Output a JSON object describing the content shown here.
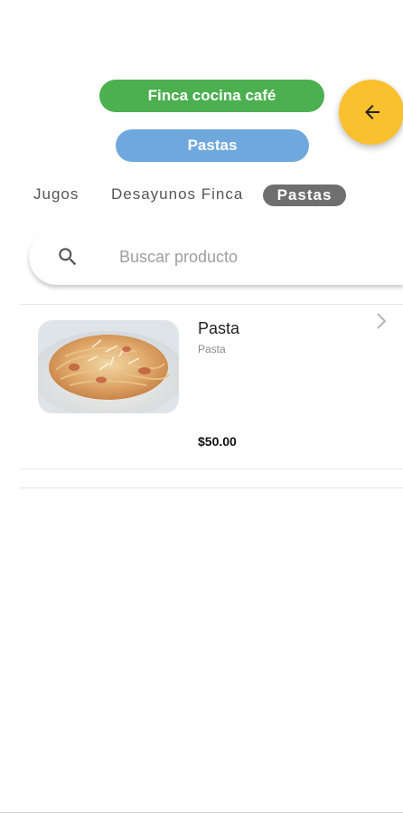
{
  "header": {
    "restaurant_label": "Finca cocina café",
    "category_label": "Pastas",
    "back_icon": "arrow-left-icon",
    "colors": {
      "restaurant_pill": "#4caf50",
      "category_pill": "#6fa8dc",
      "back_button": "#fbc02d"
    }
  },
  "tabs": [
    {
      "label": "Jugos",
      "selected": false
    },
    {
      "label": "Desayunos Finca",
      "selected": false
    },
    {
      "label": "Pastas",
      "selected": true
    }
  ],
  "search": {
    "placeholder": "Buscar producto",
    "value": "",
    "icon": "search-icon"
  },
  "products": [
    {
      "name": "Pasta",
      "description": "Pasta",
      "price": "$50.00",
      "image": "pasta-dish-photo",
      "icon": "chevron-right-icon"
    }
  ]
}
